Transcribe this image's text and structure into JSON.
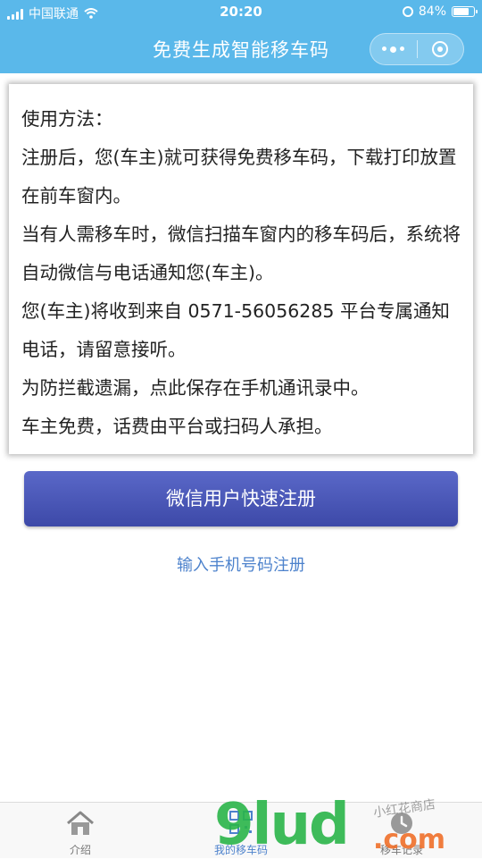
{
  "status_bar": {
    "carrier": "中国联通",
    "time": "20:20",
    "battery": "84%",
    "battery_level": 0.84
  },
  "nav": {
    "title": "免费生成智能移车码"
  },
  "instructions": {
    "lines": [
      "使用方法：",
      "注册后，您(车主)就可获得免费移车码，下载打印放置在前车窗内。",
      "当有人需移车时，微信扫描车窗内的移车码后，系统将自动微信与电话通知您(车主)。",
      "您(车主)将收到来自 0571-56056285 平台专属通知电话，请留意接听。",
      "为防拦截遗漏，点此保存在手机通讯录中。",
      "车主免费，话费由平台或扫码人承担。"
    ]
  },
  "actions": {
    "wechat_register": "微信用户快速注册",
    "phone_register": "输入手机号码注册"
  },
  "tabs": [
    {
      "label": "介绍",
      "icon": "home-icon",
      "active": false
    },
    {
      "label": "我的移车码",
      "icon": "qrcode-icon",
      "active": true
    },
    {
      "label": "移车记录",
      "icon": "clock-icon",
      "active": false
    }
  ],
  "watermark": {
    "brand": "9lud",
    "suffix": ".com",
    "shop": "小红花商店"
  },
  "colors": {
    "header": "#5ab8ea",
    "primary_button": "#4a57b8",
    "link": "#4d82cc"
  }
}
